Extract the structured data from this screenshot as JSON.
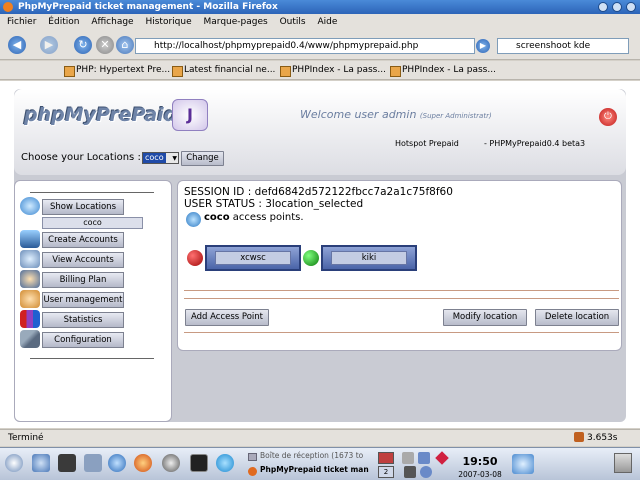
{
  "window": {
    "title": "PhpMyPrepaid ticket management - Mozilla Firefox"
  },
  "menu": [
    "Fichier",
    "Édition",
    "Affichage",
    "Historique",
    "Marque-pages",
    "Outils",
    "Aide"
  ],
  "nav": {
    "url": "http://localhost/phpmyprepaid0.4/www/phpmyprepaid.php",
    "search": "screenshoot kde"
  },
  "bookmarks": [
    "PHP: Hypertext Pre...",
    "Latest financial ne...",
    "PHPIndex - La pass...",
    "PHPIndex - La pass..."
  ],
  "header": {
    "logo": "phpMyPrePaid",
    "logo_j": "J",
    "welcome": "Welcome user admin",
    "role": "(Super Administratr)",
    "hotspot": "Hotspot Prepaid",
    "version": "- PHPMyPrepaid0.4 beta3",
    "choose_label": "Choose your Locations :",
    "location_value": "coco",
    "change_button": "Change"
  },
  "sidebar": {
    "items": [
      {
        "label": "Show Locations",
        "icon": "globe-icon"
      },
      {
        "label": "Create Accounts",
        "icon": "monitor-user-icon"
      },
      {
        "label": "View Accounts",
        "icon": "magnifier-icon"
      },
      {
        "label": "Billing Plan",
        "icon": "users-icon"
      },
      {
        "label": "User management",
        "icon": "user-icon"
      },
      {
        "label": "Statistics",
        "icon": "chart-icon"
      },
      {
        "label": "Configuration",
        "icon": "tools-icon"
      }
    ],
    "sub_location": "coco"
  },
  "main": {
    "session": "SESSION ID : defd6842d572122fbcc7a2a1c75f8f60",
    "user_status": "USER STATUS : 3location_selected",
    "ap_name": "coco",
    "ap_suffix": "access points.",
    "access_points": [
      {
        "name": "xcwsc",
        "status": "offline",
        "color": "#b01010"
      },
      {
        "name": "kiki",
        "status": "online",
        "color": "#1a9a1a"
      }
    ],
    "add_button": "Add Access Point",
    "modify_button": "Modify location",
    "delete_button": "Delete location"
  },
  "status": {
    "text": "Terminé",
    "timer": "3.653s"
  },
  "taskbar": {
    "inbox": "Boîte de réception (1673 to",
    "firefox_task": "PhpMyPrepaid ticket man",
    "desktop": "2",
    "time": "19:50",
    "date": "2007-03-08"
  }
}
